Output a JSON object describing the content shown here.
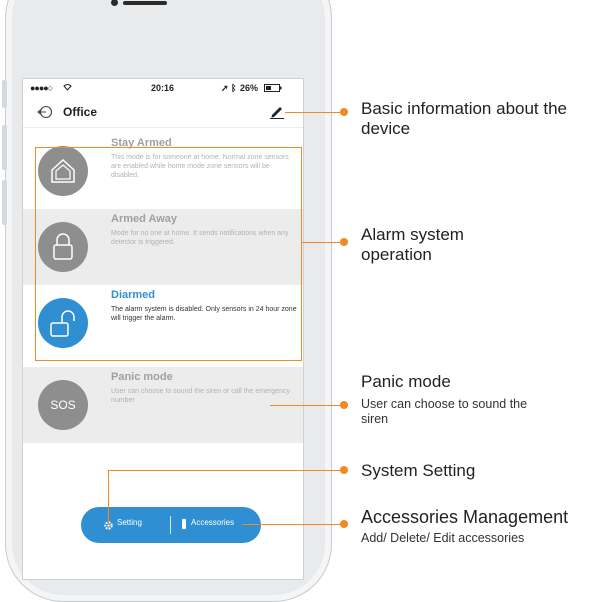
{
  "status_bar": {
    "signal": "●●●●○",
    "time": "20:16",
    "battery": "26%"
  },
  "nav": {
    "title": "Office",
    "back_icon": "back-arrow-icon",
    "edit_icon": "pencil-icon"
  },
  "modes": [
    {
      "title": "Stay Armed",
      "description": "This mode is for someone at home. Normal zone sensors are enabled while home mode zone sensors will be disabled.",
      "icon": "house-icon",
      "active": false
    },
    {
      "title": "Armed Away",
      "description": "Mode for no one at home. It sends notifications when any detector is triggered.",
      "icon": "lock-closed-icon",
      "active": false
    },
    {
      "title": "Diarmed",
      "description": "The alarm system is disabled. Only sensors in 24 hour zone will trigger the alarm.",
      "icon": "lock-open-icon",
      "active": true
    },
    {
      "title": "Panic mode",
      "description": "User can choose to sound the siren or call the emergency number",
      "icon_label": "SOS",
      "active": false
    }
  ],
  "bottom_bar": {
    "setting_label": "Setting",
    "accessories_label": "Accessories"
  },
  "callouts": {
    "basic_info": "Basic information about the device",
    "alarm_system": "Alarm system operation",
    "panic_title": "Panic mode",
    "panic_sub": "User can choose to sound the siren",
    "system_setting": "System Setting",
    "accessories_title": "Accessories Management",
    "accessories_sub": "Add/ Delete/ Edit accessories"
  },
  "colors": {
    "accent": "#2f8fd2",
    "callout": "#f08a24",
    "inactive": "#8e8e8e"
  }
}
